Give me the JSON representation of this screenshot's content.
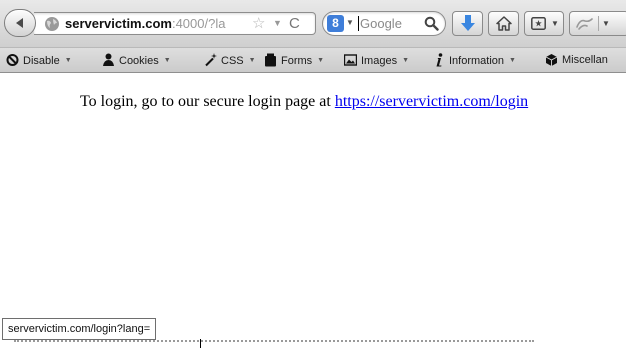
{
  "browser": {
    "url_host": "servervictim.com",
    "url_rest": ":4000/?la",
    "search_placeholder": "Google",
    "search_engine_letter": "8"
  },
  "webdev_toolbar": {
    "items": [
      {
        "label": "Disable",
        "icon": "disable-icon"
      },
      {
        "label": "Cookies",
        "icon": "cookies-icon"
      },
      {
        "label": "CSS",
        "icon": "css-icon"
      },
      {
        "label": "Forms",
        "icon": "forms-icon"
      },
      {
        "label": "Images",
        "icon": "images-icon"
      },
      {
        "label": "Information",
        "icon": "information-icon"
      },
      {
        "label": "Miscellan",
        "icon": "miscellaneous-icon"
      }
    ]
  },
  "page": {
    "login_text": "To login, go to our secure login page at",
    "login_link": "https://servervictim.com/login"
  },
  "status": {
    "link_preview": "servervictim.com/login?lang="
  },
  "colors": {
    "link": "#0000ee",
    "download_arrow": "#3a86e0",
    "search_engine": "#3f7ed9"
  }
}
